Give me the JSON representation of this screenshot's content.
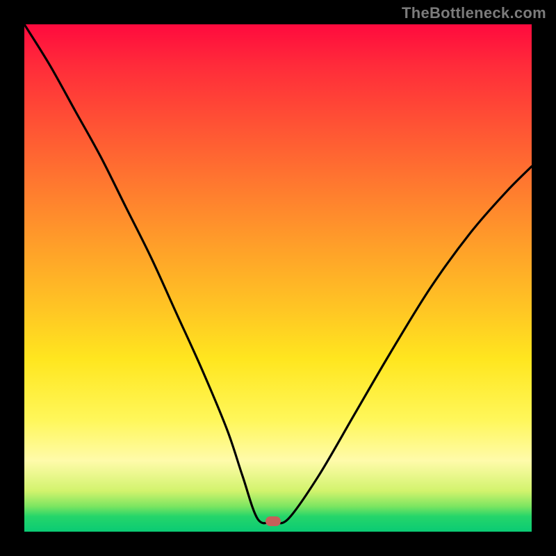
{
  "watermark": "TheBottleneck.com",
  "chart_data": {
    "type": "line",
    "title": "",
    "xlabel": "",
    "ylabel": "",
    "xlim": [
      0,
      100
    ],
    "ylim": [
      0,
      100
    ],
    "notes": "Bottleneck-style curve over a vertical heat gradient. V-shaped curve with minimum near x≈49. Left branch steeper than right. Small flat plateau at the valley bottom and a red-brown marker at the minimum.",
    "gradient_stops": [
      {
        "pct": 0,
        "color": "#ff0a3e"
      },
      {
        "pct": 8,
        "color": "#ff2b3a"
      },
      {
        "pct": 20,
        "color": "#ff5334"
      },
      {
        "pct": 32,
        "color": "#ff7a2f"
      },
      {
        "pct": 44,
        "color": "#ffa029"
      },
      {
        "pct": 56,
        "color": "#ffc524"
      },
      {
        "pct": 66,
        "color": "#ffe61f"
      },
      {
        "pct": 78,
        "color": "#fff75a"
      },
      {
        "pct": 86,
        "color": "#fffbaa"
      },
      {
        "pct": 92,
        "color": "#d2f36d"
      },
      {
        "pct": 95,
        "color": "#7ce561"
      },
      {
        "pct": 97,
        "color": "#25d56a"
      },
      {
        "pct": 100,
        "color": "#0acb74"
      }
    ],
    "marker": {
      "x": 49,
      "y": 2,
      "color": "#c6605a"
    },
    "series": [
      {
        "name": "bottleneck-curve",
        "x": [
          0,
          5,
          10,
          15,
          20,
          25,
          30,
          35,
          40,
          43,
          46,
          49,
          52,
          58,
          65,
          72,
          80,
          88,
          95,
          100
        ],
        "y": [
          100,
          92,
          83,
          74,
          64,
          54,
          43,
          32,
          20,
          11,
          2.5,
          2,
          2.5,
          11,
          23,
          35,
          48,
          59,
          67,
          72
        ]
      }
    ]
  }
}
